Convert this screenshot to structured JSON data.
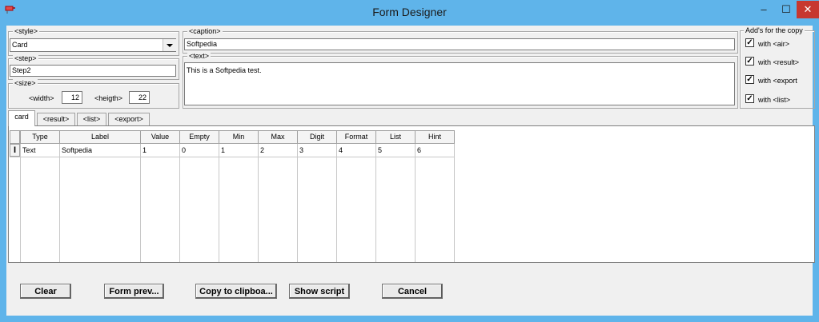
{
  "window": {
    "title": "Form Designer",
    "minimize_glyph": "–",
    "maximize_glyph": "☐",
    "close_glyph": "✕",
    "app_icon": "pin-icon"
  },
  "style": {
    "label": "<style>",
    "value": "Card"
  },
  "step": {
    "label": "<step>",
    "value": "Step2"
  },
  "size": {
    "label": "<size>",
    "width_label": "<width>",
    "width_value": "12",
    "height_label": "<heigth>",
    "height_value": "22"
  },
  "caption": {
    "label": "<caption>",
    "value": "Softpedia"
  },
  "text": {
    "label": "<text>",
    "value": "This is a Softpedia test."
  },
  "copy_options": {
    "label": "Add's for the copy",
    "items": [
      {
        "label": "with <air>",
        "checked": true
      },
      {
        "label": "with <result>",
        "checked": true
      },
      {
        "label": "with <export",
        "checked": true
      },
      {
        "label": "with <list>",
        "checked": true
      }
    ]
  },
  "tabs": [
    "card",
    "<result>",
    "<list>",
    "<export>"
  ],
  "grid": {
    "columns": [
      "Type",
      "Label",
      "Value",
      "Empty",
      "Min",
      "Max",
      "Digit",
      "Format",
      "List",
      "Hint"
    ],
    "rows": [
      [
        "Text",
        "Softpedia",
        "1",
        "0",
        "1",
        "2",
        "3",
        "4",
        "5",
        "6"
      ]
    ]
  },
  "buttons": {
    "clear": "Clear",
    "form_preview": "Form prev...",
    "copy_clipboard": "Copy to clipboa...",
    "show_script": "Show script",
    "cancel": "Cancel"
  },
  "colors": {
    "titlebar": "#5fb4ea",
    "close_button": "#c7372f"
  }
}
